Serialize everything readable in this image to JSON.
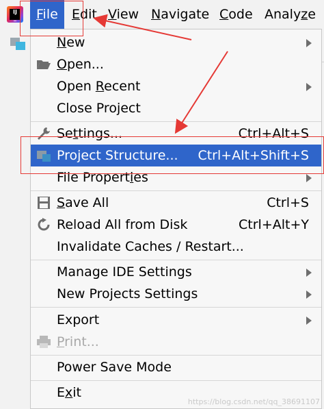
{
  "menubar": {
    "items": [
      {
        "pre": "",
        "key": "F",
        "post": "ile"
      },
      {
        "pre": "",
        "key": "E",
        "post": "dit"
      },
      {
        "pre": "",
        "key": "V",
        "post": "iew"
      },
      {
        "pre": "",
        "key": "N",
        "post": "avigate"
      },
      {
        "pre": "",
        "key": "C",
        "post": "ode"
      },
      {
        "pre": "Analy",
        "key": "z",
        "post": "e"
      }
    ],
    "active_color": "#2f65ca"
  },
  "file_menu": {
    "new": {
      "pre": "",
      "key": "N",
      "post": "ew"
    },
    "open": {
      "pre": "",
      "key": "O",
      "post": "pen..."
    },
    "open_recent": {
      "pre": "Open ",
      "key": "R",
      "post": "ecent"
    },
    "close_project": {
      "pre": "Close Pro",
      "key": "j",
      "post": "ect"
    },
    "settings": {
      "pre": "Se",
      "key": "t",
      "post": "tings...",
      "shortcut": "Ctrl+Alt+S"
    },
    "project_structure": {
      "pre": "Project Structure...",
      "key": "",
      "post": "",
      "shortcut": "Ctrl+Alt+Shift+S"
    },
    "file_properties": {
      "pre": "File Propert",
      "key": "i",
      "post": "es"
    },
    "save_all": {
      "pre": "",
      "key": "S",
      "post": "ave All",
      "shortcut": "Ctrl+S"
    },
    "reload": {
      "pre": "Reload All from Disk",
      "key": "",
      "post": "",
      "shortcut": "Ctrl+Alt+Y"
    },
    "invalidate": {
      "pre": "Invalidate Caches / Restart...",
      "key": "",
      "post": ""
    },
    "manage_ide": {
      "pre": "Manage IDE Settings",
      "key": "",
      "post": ""
    },
    "new_projects_settings": {
      "pre": "New Projects Settings",
      "key": "",
      "post": ""
    },
    "export": {
      "pre": "Export",
      "key": "",
      "post": ""
    },
    "print": {
      "pre": "",
      "key": "P",
      "post": "rint..."
    },
    "power_save": {
      "pre": "Power Save Mode",
      "key": "",
      "post": ""
    },
    "exit": {
      "pre": "E",
      "key": "x",
      "post": "it"
    }
  },
  "icons": {
    "app": "intellij-logo-icon",
    "project": "project-folder-icon",
    "open": "folder-open-icon",
    "settings": "wrench-icon",
    "project_structure": "project-structure-icon",
    "save": "floppy-disk-icon",
    "reload": "reload-icon",
    "print": "printer-icon",
    "submenu": "chevron-right-icon"
  },
  "watermark": "https://blog.csdn.net/qq_38691107",
  "annotation_color": "#e53935",
  "selection_color": "#2f65ca"
}
